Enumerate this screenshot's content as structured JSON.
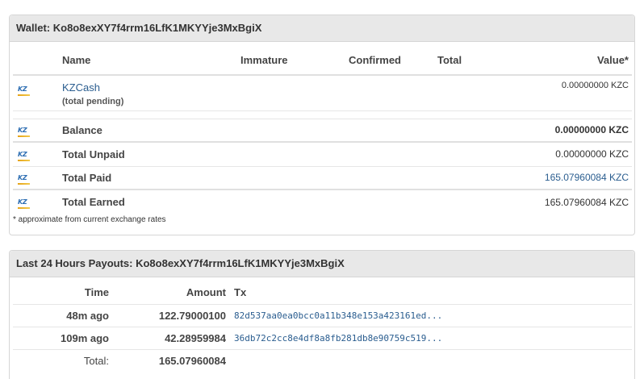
{
  "wallet": {
    "title": "Wallet: Ko8o8exXY7f4rrm16LfK1MKYYje3MxBgiX",
    "columns": {
      "name": "Name",
      "immature": "Immature",
      "confirmed": "Confirmed",
      "total": "Total",
      "value": "Value*"
    },
    "coin": {
      "icon": "kzc-coin-icon",
      "name": "KZCash",
      "sub": "(total pending)",
      "value": "0.00000000 KZC"
    },
    "rows": [
      {
        "label": "Balance",
        "value": "0.00000000 KZC"
      },
      {
        "label": "Total Unpaid",
        "value": "0.00000000 KZC"
      },
      {
        "label": "Total Paid",
        "value": "165.07960084 KZC"
      },
      {
        "label": "Total Earned",
        "value": "165.07960084 KZC"
      }
    ],
    "footnote": "* approximate from current exchange rates",
    "icon_text": "KZ"
  },
  "payouts": {
    "title": "Last 24 Hours Payouts: Ko8o8exXY7f4rrm16LfK1MKYYje3MxBgiX",
    "columns": {
      "time": "Time",
      "amount": "Amount",
      "tx": "Tx"
    },
    "rows": [
      {
        "time": "48m ago",
        "amount": "122.79000100",
        "tx": "82d537aa0ea0bcc0a11b348e153a423161ed..."
      },
      {
        "time": "109m ago",
        "amount": "42.28959984",
        "tx": "36db72c2cc8e4df8a8fb281db8e90759c519..."
      }
    ],
    "total_label": "Total:",
    "total_amount": "165.07960084"
  },
  "colors": {
    "link": "#2a5d8f",
    "header_bg": "#e8e8e8",
    "border": "#d6d6d6"
  }
}
